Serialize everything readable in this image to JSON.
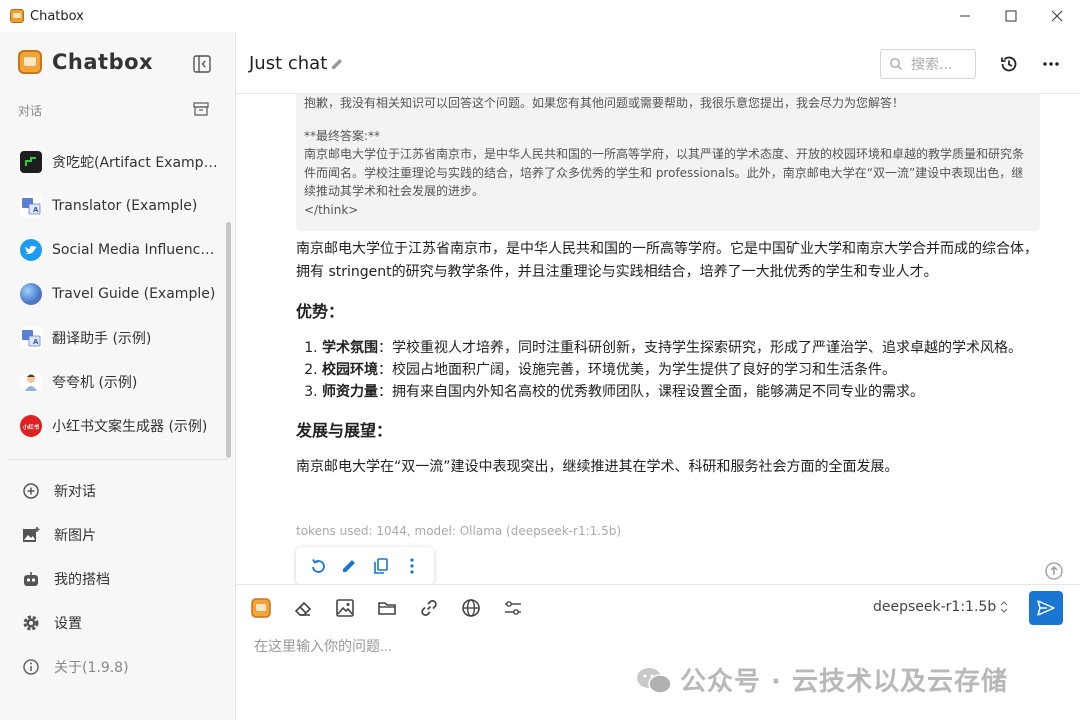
{
  "window": {
    "title": "Chatbox"
  },
  "sidebar": {
    "brand": "Chatbox",
    "section_label": "对话",
    "conversations": [
      {
        "label": "贪吃蛇(Artifact Example)",
        "avatar_color": "#1e1e1e"
      },
      {
        "label": "Translator (Example)",
        "avatar_color": "#ffffff"
      },
      {
        "label": "Social Media Influencer (Example)",
        "avatar_color": "#1d9bf0"
      },
      {
        "label": "Travel Guide (Example)",
        "avatar_color": "#5b8fd6"
      },
      {
        "label": "翻译助手 (示例)",
        "avatar_color": "#ffffff"
      },
      {
        "label": "夸夸机 (示例)",
        "avatar_color": "#ffffff"
      },
      {
        "label": "小红书文案生成器 (示例)",
        "avatar_color": "#e02020",
        "avatar_text": "小红书"
      }
    ],
    "menu": [
      {
        "label": "新对话",
        "icon": "plus-circle-icon"
      },
      {
        "label": "新图片",
        "icon": "image-add-icon"
      },
      {
        "label": "我的搭档",
        "icon": "robot-icon"
      },
      {
        "label": "设置",
        "icon": "gear-icon"
      },
      {
        "label": "关于(1.9.8)",
        "icon": "info-icon"
      }
    ]
  },
  "header": {
    "chat_title": "Just chat",
    "search_placeholder": "搜索..."
  },
  "message": {
    "think_lines": [
      "抱歉，我没有相关知识可以回答这个问题。如果您有其他问题或需要帮助，我很乐意您提出，我会尽力为您解答！",
      "",
      "**最终答案:**",
      "南京邮电大学位于江苏省南京市，是中华人民共和国的一所高等学府，以其严谨的学术态度、开放的校园环境和卓越的教学质量和研究条件而闻名。学校注重理论与实践的结合，培养了众多优秀的学生和 professionals。此外，南京邮电大学在“双一流”建设中表现出色，继续推动其学术和社会发展的进步。",
      "</think>"
    ],
    "intro": "南京邮电大学位于江苏省南京市，是中华人民共和国的一所高等学府。它是中国矿业大学和南京大学合并而成的综合体，拥有 stringent的研究与教学条件，并且注重理论与实践相结合，培养了一大批优秀的学生和专业人才。",
    "heading_1": "优势：",
    "list": [
      {
        "term": "学术氛围",
        "text": "：学校重视人才培养，同时注重科研创新，支持学生探索研究，形成了严谨治学、追求卓越的学术风格。"
      },
      {
        "term": "校园环境",
        "text": "：校园占地面积广阔，设施完善，环境优美，为学生提供了良好的学习和生活条件。"
      },
      {
        "term": "师资力量",
        "text": "：拥有来自国内外知名高校的优秀教师团队，课程设置全面，能够满足不同专业的需求。"
      }
    ],
    "heading_2": "发展与展望：",
    "conclusion": "南京邮电大学在“双一流”建设中表现突出，继续推进其在学术、科研和服务社会方面的全面发展。",
    "meta": "tokens used: 1044, model: Ollama (deepseek-r1:1.5b)"
  },
  "composer": {
    "model": "deepseek-r1:1.5b",
    "placeholder": "在这里输入你的问题..."
  },
  "watermark": {
    "text": "公众号 · 云技术以及云存储"
  },
  "colors": {
    "accent": "#1976d2",
    "sidebar_bg": "#f7f7f7",
    "think_bg": "#f3f3f3"
  }
}
